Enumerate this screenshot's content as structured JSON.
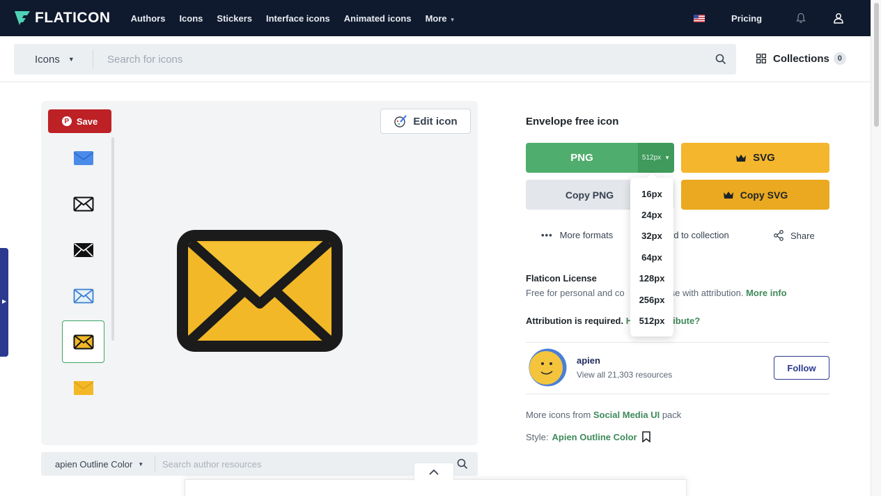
{
  "header": {
    "logo": "FLATICON",
    "nav": [
      "Authors",
      "Icons",
      "Stickers",
      "Interface icons",
      "Animated icons"
    ],
    "more": "More",
    "pricing": "Pricing"
  },
  "search": {
    "category": "Icons",
    "placeholder": "Search for icons",
    "collections_label": "Collections",
    "collections_count": "0"
  },
  "preview": {
    "save_label": "Save",
    "edit_label": "Edit icon",
    "thumbnails": [
      "envelope-blue",
      "envelope-outline",
      "envelope-filled-black",
      "envelope-blue-outline",
      "envelope-outline-color",
      "envelope-yellow"
    ],
    "selected_thumbnail": 4,
    "style_select": "apien Outline Color",
    "author_search_placeholder": "Search author resources"
  },
  "details": {
    "title": "Envelope free icon",
    "png_label": "PNG",
    "png_size": "512px",
    "svg_label": "SVG",
    "copy_png_label": "Copy PNG",
    "copy_svg_label": "Copy SVG",
    "more_formats": "More formats",
    "add_to_collection": "dd to collection",
    "share": "Share",
    "license_title": "Flaticon License",
    "license_text_a": "Free for personal and co",
    "license_text_b": "urpose with attribution.",
    "license_more": "More info",
    "attribution_a": "Attribution is required.",
    "attribution_link_a": "H",
    "attribution_link_b": "ibute?",
    "author_name": "apien",
    "author_resources": "View all 21,303 resources",
    "follow_label": "Follow",
    "pack_prefix": "More icons from",
    "pack_name": "Social Media UI",
    "pack_suffix": "pack",
    "style_prefix": "Style:",
    "style_name": "Apien Outline Color"
  },
  "size_options": [
    "16px",
    "24px",
    "32px",
    "64px",
    "128px",
    "256px",
    "512px"
  ],
  "colors": {
    "header_bg": "#0f1a2e",
    "png_green": "#4fae6d",
    "svg_yellow": "#f4b62c",
    "link_green": "#3f8a5a",
    "pinterest_red": "#bd2126",
    "envelope_yellow": "#f2b827"
  }
}
